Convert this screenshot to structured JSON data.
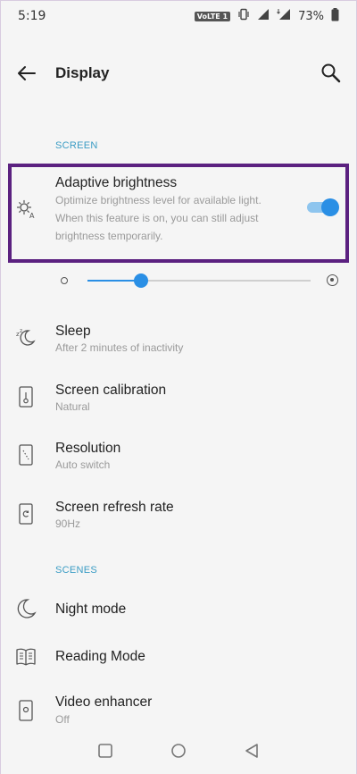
{
  "status": {
    "time": "5:19",
    "network": "VoLTE 1",
    "battery": "73%"
  },
  "header": {
    "title": "Display"
  },
  "sections": {
    "screen": "SCREEN",
    "scenes": "SCENES"
  },
  "adaptive": {
    "title": "Adaptive brightness",
    "desc_1": "Optimize brightness level for available light.",
    "desc_2": "When this feature is on, you can still adjust",
    "desc_3": "brightness temporarily.",
    "enabled": true
  },
  "brightness": {
    "level": 0.24
  },
  "items": [
    {
      "title": "Sleep",
      "sub": "After 2 minutes of inactivity",
      "icon": "sleep-icon"
    },
    {
      "title": "Screen calibration",
      "sub": "Natural",
      "icon": "thermometer-icon"
    },
    {
      "title": "Resolution",
      "sub": "Auto switch",
      "icon": "resolution-icon"
    },
    {
      "title": "Screen refresh rate",
      "sub": "90Hz",
      "icon": "refresh-rate-icon"
    }
  ],
  "scenes": [
    {
      "title": "Night mode",
      "icon": "moon-icon"
    },
    {
      "title": "Reading Mode",
      "icon": "book-icon"
    },
    {
      "title": "Video enhancer",
      "sub": "Off",
      "icon": "video-enhancer-icon"
    }
  ],
  "colors": {
    "accent": "#2a8fe5",
    "section": "#3a9cc4",
    "highlight": "#5b2180"
  }
}
